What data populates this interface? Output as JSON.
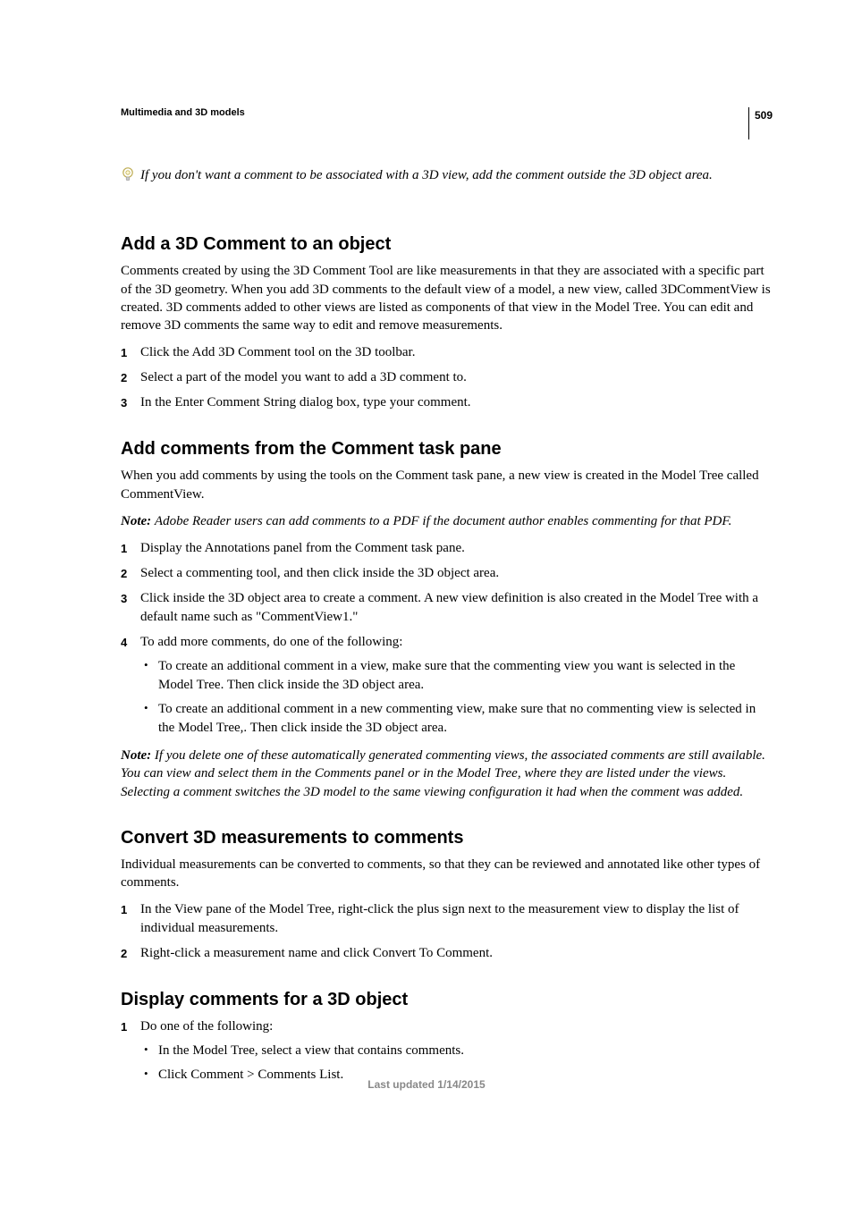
{
  "page_number": "509",
  "running_head": "Multimedia and 3D models",
  "tip": "If you don't want a comment to be associated with a 3D view, add the comment outside the 3D object area.",
  "section1": {
    "heading": "Add a 3D Comment to an object",
    "para": "Comments created by using the 3D Comment Tool are like measurements in that they are associated with a specific part of the 3D geometry. When you add 3D comments to the default view of a model, a new view, called 3DCommentView is created. 3D comments added to other views are listed as components of that view in the Model Tree. You can edit and remove 3D comments the same way to edit and remove measurements.",
    "steps": [
      "Click the Add 3D Comment tool on the 3D toolbar.",
      "Select a part of the model you want to add a 3D comment to.",
      "In the Enter Comment String dialog box, type your comment."
    ]
  },
  "section2": {
    "heading": "Add comments from the Comment task pane",
    "para": "When you add comments by using the tools on the Comment task pane, a new view is created in the Model Tree called CommentView.",
    "note_label": "Note: ",
    "note": "Adobe Reader users can add comments to a PDF if the document author enables commenting for that PDF.",
    "steps": [
      "Display the Annotations panel from the Comment task pane.",
      "Select a commenting tool, and then click inside the 3D object area.",
      "Click inside the 3D object area to create a comment. A new view definition is also created in the Model Tree with a default name such as \"CommentView1.\"",
      "To add more comments, do one of the following:"
    ],
    "sub_bullets": [
      "To create an additional comment in a view, make sure that the commenting view you want is selected in the Model Tree. Then click inside the 3D object area.",
      "To create an additional comment in a new commenting view, make sure that no commenting view is selected in the Model Tree,. Then click inside the 3D object area."
    ],
    "note2_label": "Note: ",
    "note2": "If you delete one of these automatically generated commenting views, the associated comments are still available. You can view and select them in the Comments panel or in the Model Tree, where they are listed under the views. Selecting a comment switches the 3D model to the same viewing configuration it had when the comment was added."
  },
  "section3": {
    "heading": "Convert 3D measurements to comments",
    "para": "Individual measurements can be converted to comments, so that they can be reviewed and annotated like other types of comments.",
    "steps": [
      "In the View pane of the Model Tree, right-click the plus sign next to the measurement view to display the list of individual measurements.",
      "Right-click a measurement name and click Convert To Comment."
    ]
  },
  "section4": {
    "heading": "Display comments for a 3D object",
    "steps_0": "Do one of the following:",
    "sub_bullets": [
      "In the Model Tree, select a view that contains comments.",
      "Click Comment > Comments List."
    ]
  },
  "footer": "Last updated 1/14/2015"
}
